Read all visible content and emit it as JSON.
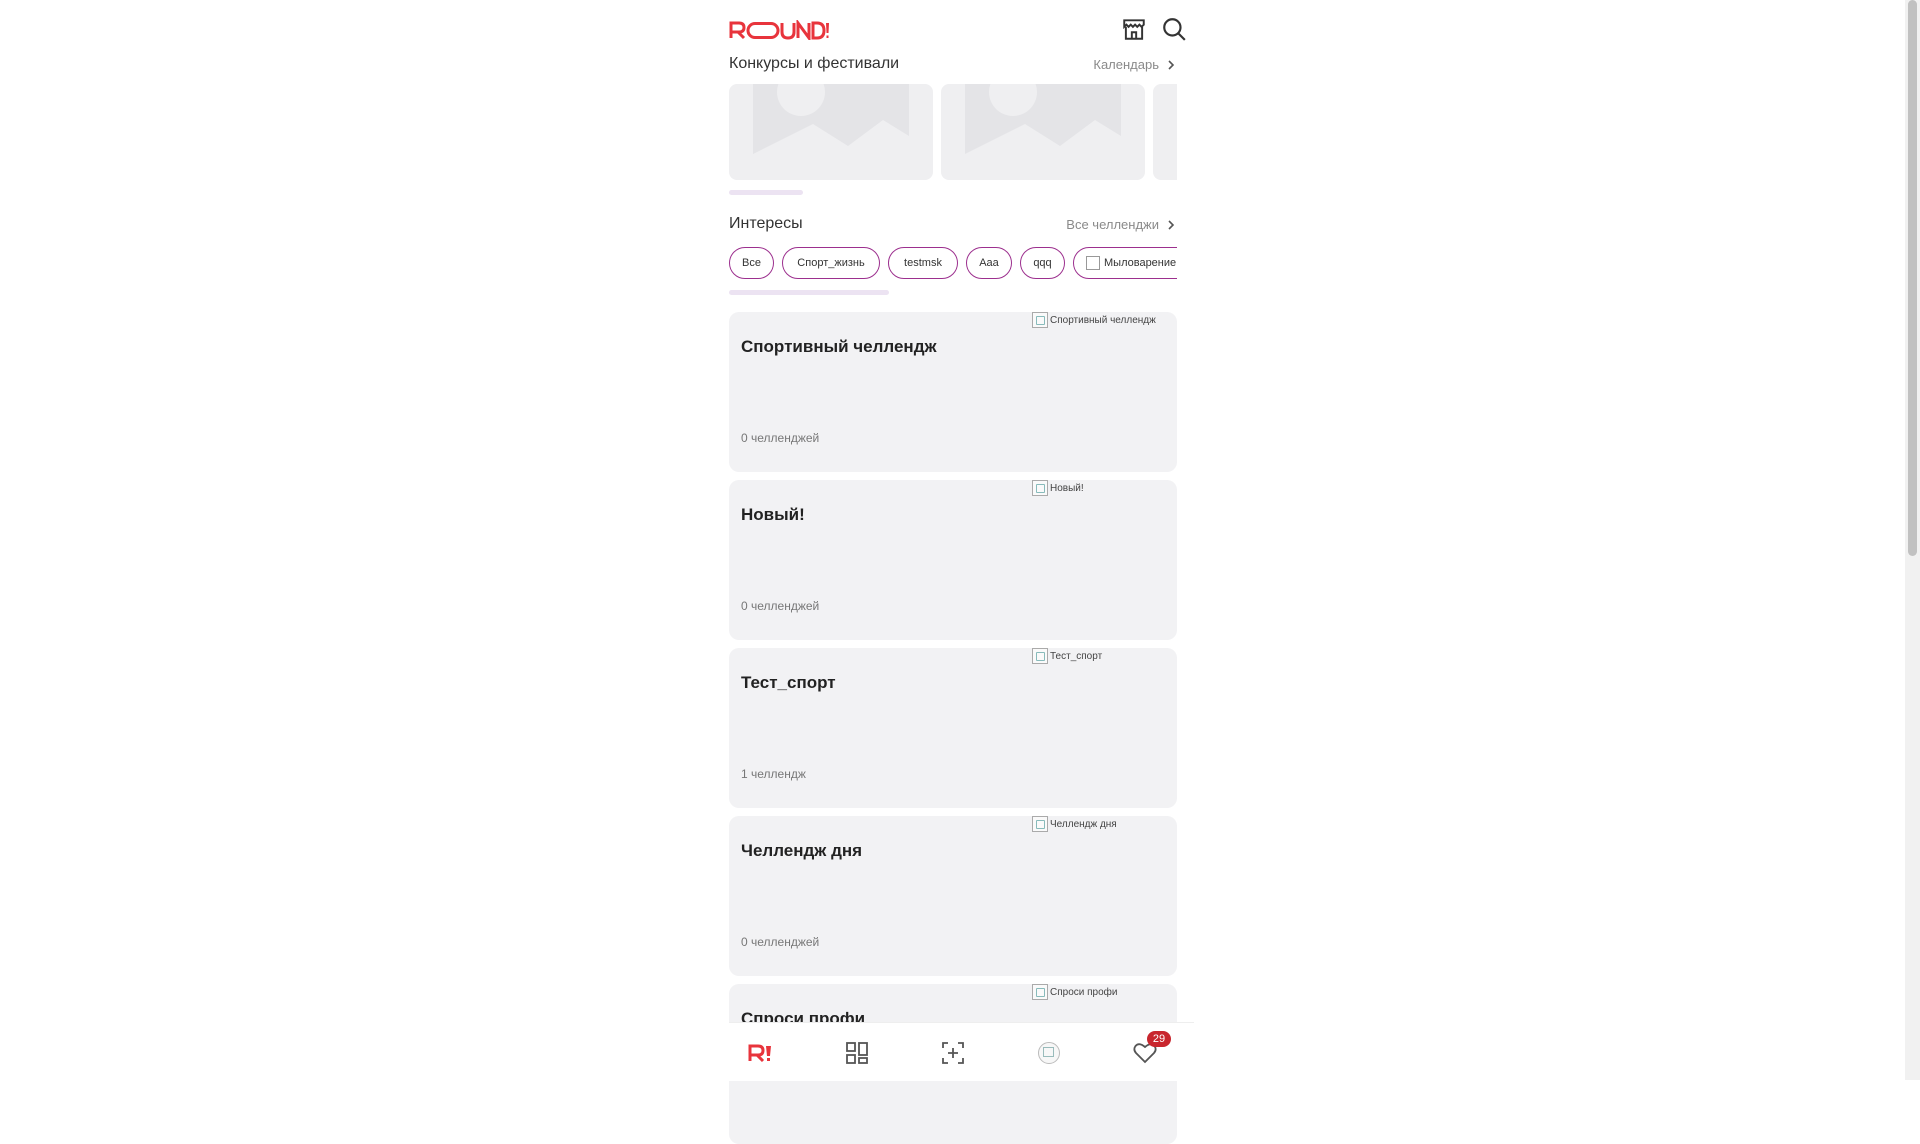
{
  "header": {
    "logo_text": "ROUND!",
    "store_icon": "store-icon",
    "search_icon": "search-icon"
  },
  "festivals": {
    "title": "Конкурсы и фестивали",
    "link": "Календарь",
    "placeholder_icon": "image-placeholder-icon"
  },
  "interests": {
    "title": "Интересы",
    "link": "Все челленджи",
    "chips": [
      "Все",
      "Спорт_жизнь",
      "testmsk",
      "Aaa",
      "qqq",
      "Мыловарение"
    ]
  },
  "cards": [
    {
      "title": "Спортивный челлендж",
      "count": "0 челленджей",
      "img_alt": "Спортивный челлендж"
    },
    {
      "title": "Новый!",
      "count": "0 челленджей",
      "img_alt": "Новый!"
    },
    {
      "title": "Тест_спорт",
      "count": "1 челлендж",
      "img_alt": "Тест_спорт"
    },
    {
      "title": "Челлендж дня",
      "count": "0 челленджей",
      "img_alt": "Челлендж дня"
    },
    {
      "title": "Спроси профи",
      "count": "",
      "img_alt": "Спроси профи"
    }
  ],
  "bottom_nav": {
    "items": [
      "home-logo-icon",
      "catalog-icon",
      "add-challenge-icon",
      "profile-avatar",
      "favorites-heart-icon"
    ],
    "favorites_badge": "29"
  },
  "colors": {
    "brand_red": "#e8343c",
    "chip_border": "#9c2f8e",
    "badge": "#c8262e",
    "card_bg": "#f2f2f4"
  }
}
